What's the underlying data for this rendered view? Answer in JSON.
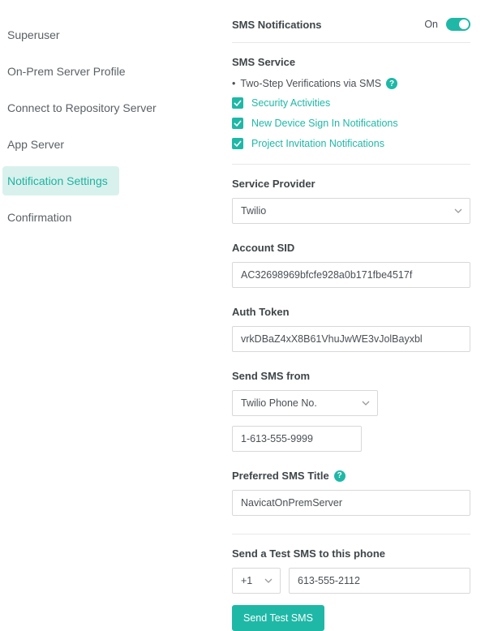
{
  "sidebar": {
    "items": [
      {
        "label": "Superuser"
      },
      {
        "label": "On-Prem Server Profile"
      },
      {
        "label": "Connect to Repository Server"
      },
      {
        "label": "App Server"
      },
      {
        "label": "Notification Settings"
      },
      {
        "label": "Confirmation"
      }
    ],
    "active_index": 4
  },
  "header": {
    "title": "SMS Notifications",
    "toggle_label": "On",
    "toggle_on": true
  },
  "sms_service": {
    "title": "SMS Service",
    "bullet": "Two-Step Verifications via SMS",
    "checks": [
      {
        "label": "Security Activities",
        "checked": true
      },
      {
        "label": "New Device Sign In Notifications",
        "checked": true
      },
      {
        "label": "Project Invitation Notifications",
        "checked": true
      }
    ]
  },
  "provider": {
    "label": "Service Provider",
    "value": "Twilio"
  },
  "account_sid": {
    "label": "Account SID",
    "value": "AC32698969bfcfe928a0b171fbe4517f"
  },
  "auth_token": {
    "label": "Auth Token",
    "value": "vrkDBaZ4xX8B61VhuJwWE3vJolBayxbl"
  },
  "send_from": {
    "label": "Send SMS from",
    "select_value": "Twilio Phone No.",
    "phone_value": "1-613-555-9999"
  },
  "pref_title": {
    "label": "Preferred SMS Title",
    "value": "NavicatOnPremServer"
  },
  "test_sms": {
    "label": "Send a Test SMS to this phone",
    "cc_value": "+1",
    "phone_value": "613-555-2112",
    "button_label": "Send Test SMS"
  }
}
